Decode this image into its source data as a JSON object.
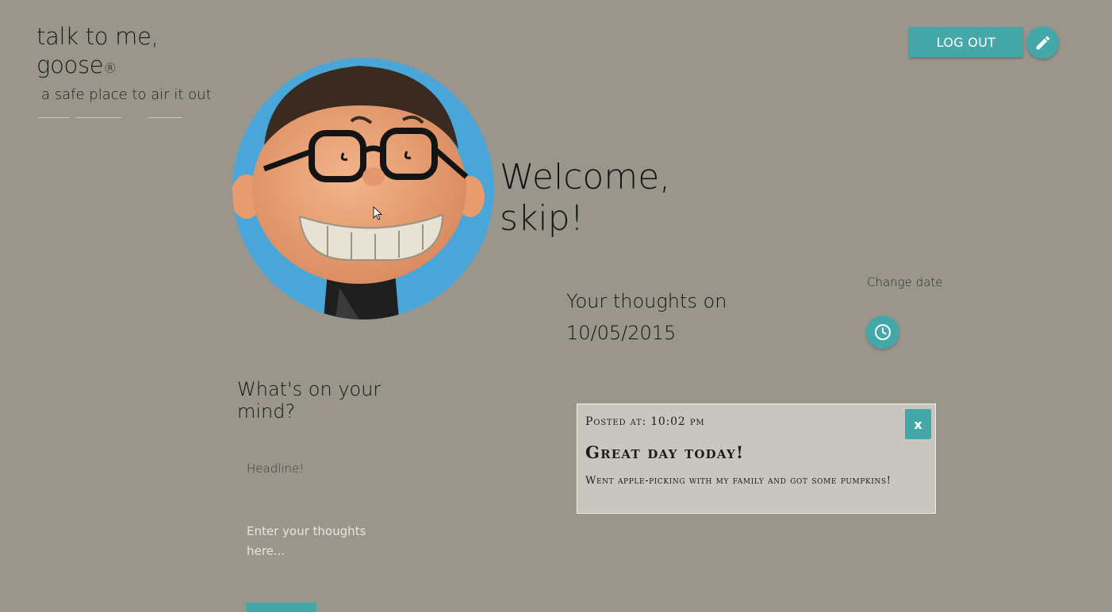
{
  "brand": {
    "name": "talk to me, goose",
    "registered": "®",
    "tagline": "a safe place to air it out"
  },
  "header": {
    "logout_label": "LOG OUT",
    "edit_icon": "pencil-icon"
  },
  "welcome": {
    "text": "Welcome, skip!"
  },
  "date_section": {
    "title": "Your thoughts on 10/05/2015",
    "change_date_label": "Change date",
    "clock_icon": "clock-icon"
  },
  "compose": {
    "heading": "What's on your mind?",
    "headline_placeholder": "Headline!",
    "thoughts_placeholder": "Enter your thoughts here..."
  },
  "post": {
    "posted_at": "Posted at: 10:02 pm",
    "title": "Great day today!",
    "body": "Went apple-picking with my family and got some pumpkins!",
    "delete_label": "x"
  },
  "colors": {
    "background": "#9b968c",
    "accent": "#45a8a8",
    "card": "#c8c6bf",
    "avatar_bg": "#4aa6d9"
  }
}
